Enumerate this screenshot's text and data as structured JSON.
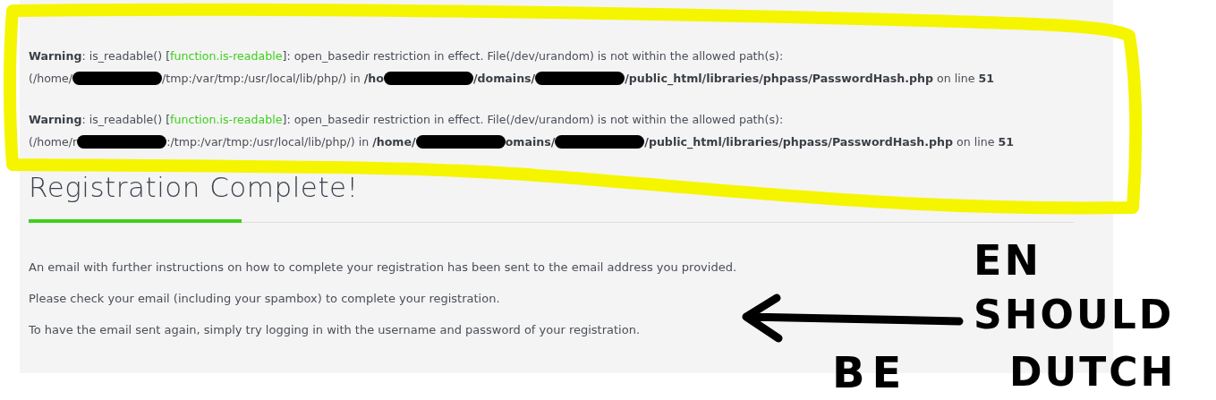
{
  "warnings": [
    {
      "label": "Warning",
      "before": ": is_readable() [",
      "link": "function.is-readable",
      "after": "]: open_basedir restriction in effect. File(/dev/urandom) is not within the allowed path(s):",
      "path": [
        {
          "kind": "text",
          "text": "(/home/"
        },
        {
          "kind": "redaction"
        },
        {
          "kind": "text",
          "text": "/tmp:/var/tmp:/usr/local/lib/php/) in "
        },
        {
          "kind": "bold",
          "text": "/ho"
        },
        {
          "kind": "redaction"
        },
        {
          "kind": "bold",
          "text": "/domains/"
        },
        {
          "kind": "redaction"
        },
        {
          "kind": "bold",
          "text": "/public_html/libraries/phpass/PasswordHash.php"
        },
        {
          "kind": "text",
          "text": " on line "
        },
        {
          "kind": "bold",
          "text": "51"
        }
      ]
    },
    {
      "label": "Warning",
      "before": ": is_readable() [",
      "link": "function.is-readable",
      "after": "]: open_basedir restriction in effect. File(/dev/urandom) is not within the allowed path(s):",
      "path": [
        {
          "kind": "text",
          "text": "(/home/r"
        },
        {
          "kind": "redaction"
        },
        {
          "kind": "text",
          "text": ":/tmp:/var/tmp:/usr/local/lib/php/) in "
        },
        {
          "kind": "bold",
          "text": "/home/"
        },
        {
          "kind": "redaction"
        },
        {
          "kind": "bold",
          "text": "omains/"
        },
        {
          "kind": "redaction"
        },
        {
          "kind": "bold",
          "text": "/public_html/libraries/phpass/PasswordHash.php"
        },
        {
          "kind": "text",
          "text": " on line "
        },
        {
          "kind": "bold",
          "text": "51"
        }
      ]
    }
  ],
  "heading": "Registration Complete!",
  "paragraphs": [
    "An email with further instructions on how to complete your registration has been sent to the email address you provided.",
    "Please check your email (including your spambox) to complete your registration.",
    "To have the email sent again, simply try logging in with the username and password of your registration."
  ],
  "annotation": {
    "words": [
      {
        "kind": "en",
        "text": "EN"
      },
      {
        "kind": "should",
        "text": "SHOULD"
      },
      {
        "kind": "be",
        "text": "BE"
      },
      {
        "kind": "dutch",
        "text": "DUTCH"
      }
    ]
  }
}
